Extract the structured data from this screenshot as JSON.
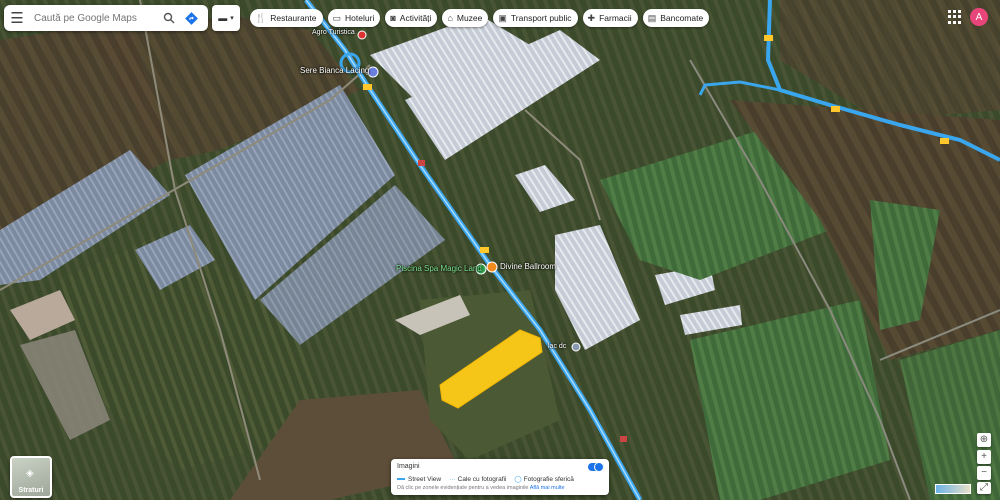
{
  "search": {
    "placeholder": "Caută pe Google Maps"
  },
  "chips": [
    {
      "label": "Restaurante",
      "icon": "fork-knife-icon"
    },
    {
      "label": "Hoteluri",
      "icon": "bed-icon"
    },
    {
      "label": "Activități",
      "icon": "camera-icon"
    },
    {
      "label": "Muzee",
      "icon": "museum-icon"
    },
    {
      "label": "Transport public",
      "icon": "bus-icon"
    },
    {
      "label": "Farmacii",
      "icon": "pharmacy-icon"
    },
    {
      "label": "Bancomate",
      "icon": "atm-icon"
    }
  ],
  "account": {
    "initial": "A",
    "color": "#e8457a"
  },
  "places": {
    "sere": "Sere Bianca Lacing",
    "piscina": "Piscina Spa Magic Land",
    "divine": "Divine Ballroom",
    "agro": "Agro Turistica",
    "small": "lac dc"
  },
  "road_shields": [
    "19",
    "19",
    "19",
    "19",
    "19",
    "19"
  ],
  "layers": {
    "label": "Straturi"
  },
  "imagery": {
    "title": "Imagini",
    "street_view": "Street View",
    "photo_path": "Cale cu fotografii",
    "spherical": "Fotografie sferică",
    "note": "Dă clic pe zonele evidențiate pentru a vedea imaginile",
    "learn_more": "Află mai multe"
  },
  "colors": {
    "highlight": "#f5c518",
    "street_view_line": "#3aa6ee",
    "accent": "#1a73e8"
  }
}
